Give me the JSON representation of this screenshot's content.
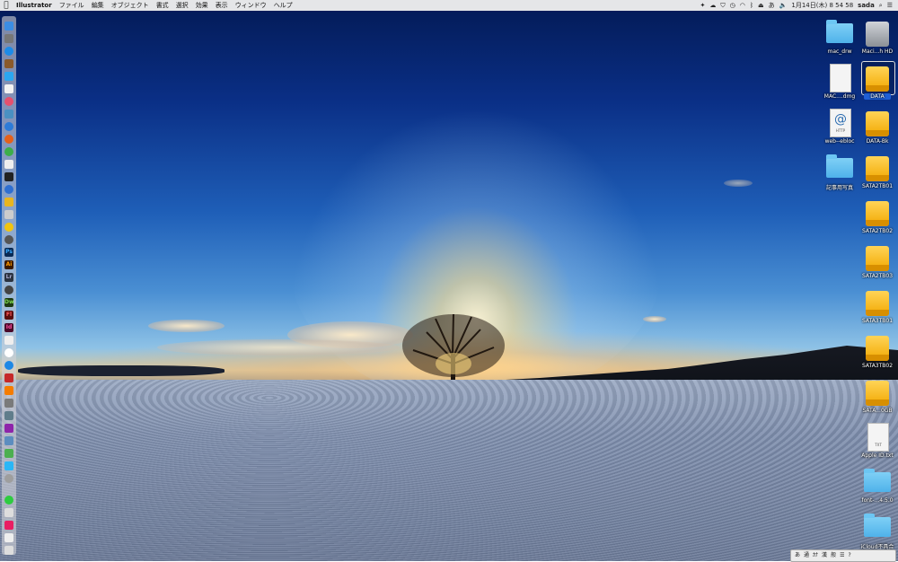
{
  "menubar": {
    "apple_icon": "apple-logo",
    "app_name": "Illustrator",
    "menus": [
      "ファイル",
      "編集",
      "オブジェクト",
      "書式",
      "選択",
      "効果",
      "表示",
      "ウィンドウ",
      "ヘルプ"
    ],
    "datetime": "1月14日(木) 8 54 58",
    "user": "sada",
    "status_icons": [
      "dropbox-icon",
      "cloud-icon",
      "shield-icon",
      "time-machine-icon",
      "wifi-icon",
      "bluetooth-icon",
      "eject-icon",
      "input-method-icon",
      "volume-icon"
    ],
    "right_icons": [
      "spotlight-icon",
      "notification-center-icon"
    ]
  },
  "desktop_icons": [
    {
      "label": "mac_drw",
      "type": "folder"
    },
    {
      "label": "Maci...h HD",
      "type": "hd"
    },
    {
      "label": "MAC....dmg",
      "type": "doc"
    },
    {
      "label": "DATA",
      "type": "drive",
      "selected": true
    },
    {
      "label": "web--ebloc",
      "type": "doc-at"
    },
    {
      "label": "DATA-Bk",
      "type": "drive"
    },
    {
      "label": "記事用写真",
      "type": "folder"
    },
    {
      "label": "SATA2TB01",
      "type": "drive"
    },
    {
      "label": "SATA2TB02",
      "type": "drive"
    },
    {
      "label": "SATA2TB03",
      "type": "drive"
    },
    {
      "label": "SATA3TB01",
      "type": "drive"
    },
    {
      "label": "SATA3TB02",
      "type": "drive"
    },
    {
      "label": "SATA...0GB",
      "type": "drive"
    },
    {
      "label": "Apple ID.txt",
      "type": "text"
    },
    {
      "label": "font-...4.5.0",
      "type": "folder"
    },
    {
      "label": "iCloud不具合",
      "type": "folder"
    }
  ],
  "ime_palette": {
    "labels": [
      "あ",
      "通",
      "ｶﾅ",
      "漢",
      "般"
    ]
  },
  "doc_badges": {
    "at_symbol": "@",
    "http_label": "HTTP",
    "txt_label": "TXT"
  }
}
